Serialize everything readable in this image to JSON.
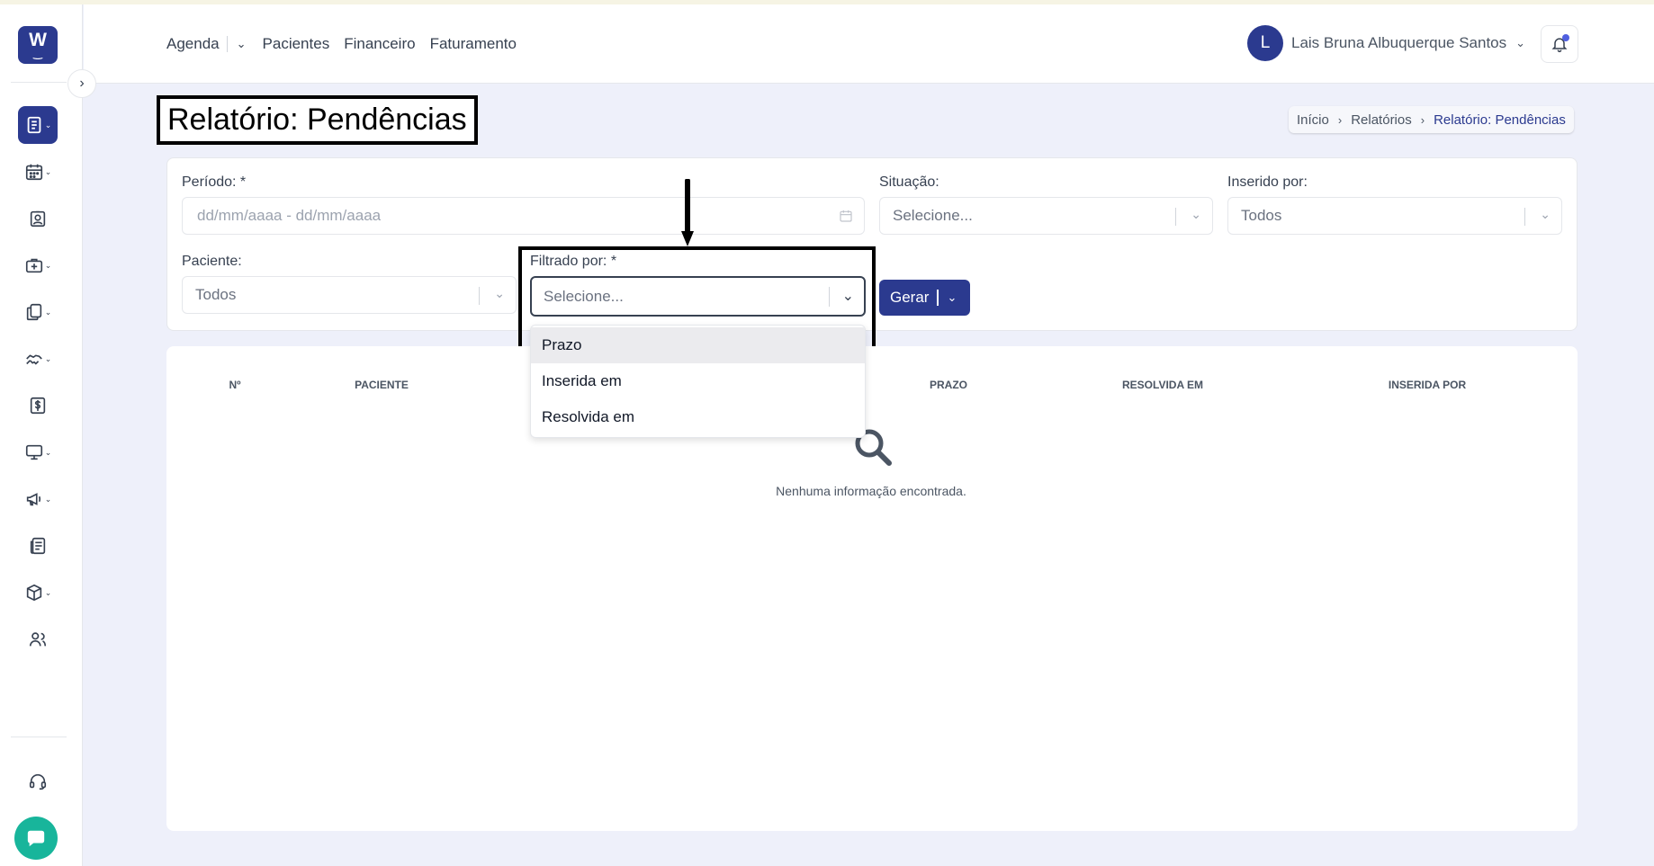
{
  "topnav": {
    "items": [
      "Agenda",
      "Pacientes",
      "Financeiro",
      "Faturamento"
    ]
  },
  "user": {
    "initial": "L",
    "name": "Lais Bruna Albuquerque Santos"
  },
  "logo": {
    "letter": "W"
  },
  "page": {
    "title": "Relatório: Pendências"
  },
  "breadcrumb": [
    "Início",
    "Relatórios",
    "Relatório: Pendências"
  ],
  "filters": {
    "periodo": {
      "label": "Período: *",
      "placeholder": "dd/mm/aaaa - dd/mm/aaaa"
    },
    "situacao": {
      "label": "Situação:",
      "value": "Selecione..."
    },
    "inserido_por": {
      "label": "Inserido por:",
      "value": "Todos"
    },
    "paciente": {
      "label": "Paciente:",
      "value": "Todos"
    },
    "filtrado_por": {
      "label": "Filtrado por: *",
      "value": "Selecione...",
      "options": [
        "Prazo",
        "Inserida em",
        "Resolvida em"
      ]
    },
    "gerar_label": "Gerar"
  },
  "table": {
    "columns": [
      "Nº",
      "PACIENTE",
      "PRAZO",
      "RESOLVIDA EM",
      "INSERIDA POR"
    ],
    "empty_message": "Nenhuma informação encontrada."
  },
  "colors": {
    "primary": "#2b3a8f",
    "chat": "#18b59b",
    "background": "#eef0fa"
  },
  "icons": [
    "book-icon",
    "calendar-icon",
    "patient-badge-icon",
    "medical-kit-icon",
    "documents-icon",
    "handshake-icon",
    "dollar-icon",
    "monitor-icon",
    "megaphone-icon",
    "newspaper-icon",
    "box-icon",
    "users-icon",
    "headset-icon",
    "chat-icon",
    "bell-icon",
    "search-icon"
  ]
}
